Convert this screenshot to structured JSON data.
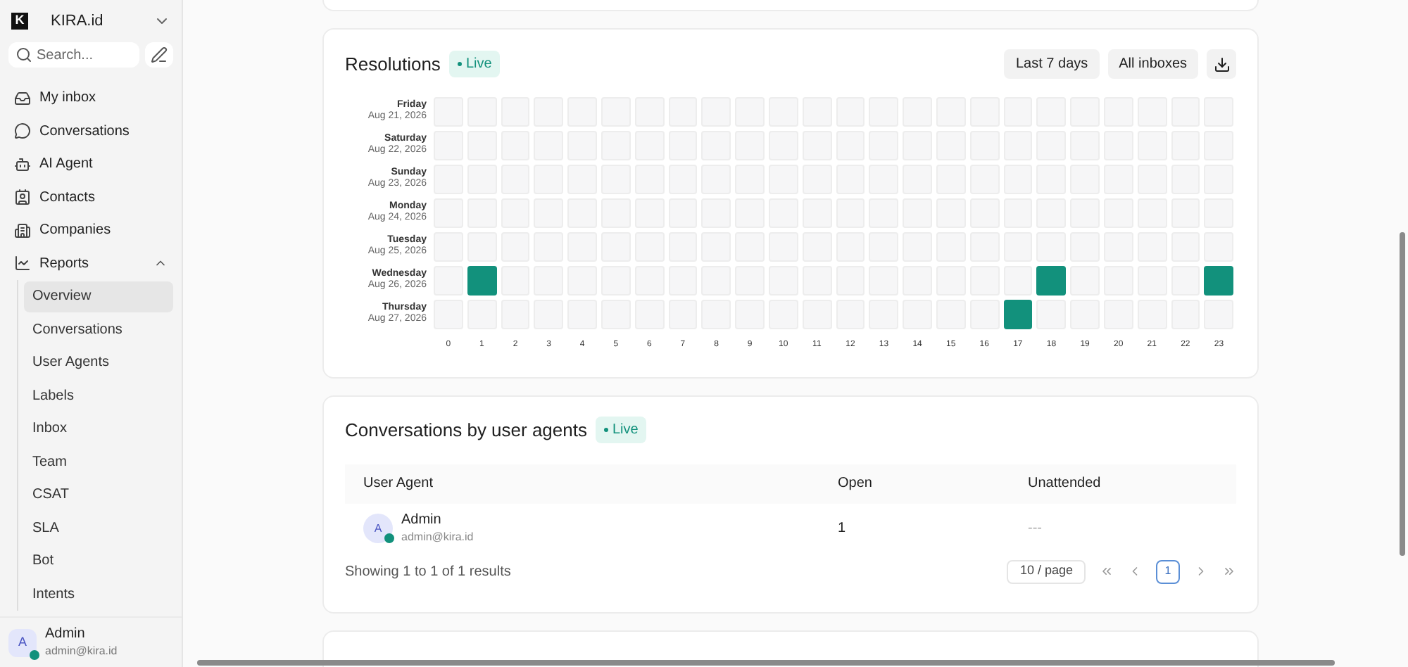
{
  "workspace": {
    "name": "KIRA.id",
    "logo": "K"
  },
  "search": {
    "placeholder": "Search..."
  },
  "nav": [
    {
      "label": "My inbox",
      "selected": false
    },
    {
      "label": "Conversations",
      "selected": false
    },
    {
      "label": "AI Agent",
      "selected": false
    },
    {
      "label": "Contacts",
      "selected": false
    },
    {
      "label": "Companies",
      "selected": false
    },
    {
      "label": "Reports",
      "selected": false,
      "expanded": true,
      "children": [
        {
          "label": "Overview",
          "selected": true
        },
        {
          "label": "Conversations",
          "selected": false
        },
        {
          "label": "User Agents",
          "selected": false
        },
        {
          "label": "Labels",
          "selected": false
        },
        {
          "label": "Inbox",
          "selected": false
        },
        {
          "label": "Team",
          "selected": false
        },
        {
          "label": "CSAT",
          "selected": false
        },
        {
          "label": "SLA",
          "selected": false
        },
        {
          "label": "Bot",
          "selected": false
        },
        {
          "label": "Intents",
          "selected": false
        }
      ]
    }
  ],
  "user": {
    "initial": "A",
    "name": "Admin",
    "email": "admin@kira.id",
    "online": true
  },
  "resolutions": {
    "title": "Resolutions",
    "badge": "Live",
    "filters": [
      "Last 7 days",
      "All inboxes"
    ],
    "rows": [
      {
        "day": "Friday",
        "date": "Aug 21, 2026",
        "filled": [
          false,
          false,
          false,
          false,
          false,
          false,
          false,
          false,
          false,
          false,
          false,
          false,
          false,
          false,
          false,
          false,
          false,
          false,
          false,
          false,
          false,
          false,
          false,
          false
        ]
      },
      {
        "day": "Saturday",
        "date": "Aug 22, 2026",
        "filled": [
          false,
          false,
          false,
          false,
          false,
          false,
          false,
          false,
          false,
          false,
          false,
          false,
          false,
          false,
          false,
          false,
          false,
          false,
          false,
          false,
          false,
          false,
          false,
          false
        ]
      },
      {
        "day": "Sunday",
        "date": "Aug 23, 2026",
        "filled": [
          false,
          false,
          false,
          false,
          false,
          false,
          false,
          false,
          false,
          false,
          false,
          false,
          false,
          false,
          false,
          false,
          false,
          false,
          false,
          false,
          false,
          false,
          false,
          false
        ]
      },
      {
        "day": "Monday",
        "date": "Aug 24, 2026",
        "filled": [
          false,
          false,
          false,
          false,
          false,
          false,
          false,
          false,
          false,
          false,
          false,
          false,
          false,
          false,
          false,
          false,
          false,
          false,
          false,
          false,
          false,
          false,
          false,
          false
        ]
      },
      {
        "day": "Tuesday",
        "date": "Aug 25, 2026",
        "filled": [
          false,
          false,
          false,
          false,
          false,
          false,
          false,
          false,
          false,
          false,
          false,
          false,
          false,
          false,
          false,
          false,
          false,
          false,
          false,
          false,
          false,
          false,
          false,
          false
        ]
      },
      {
        "day": "Wednesday",
        "date": "Aug 26, 2026",
        "filled": [
          false,
          true,
          false,
          false,
          false,
          false,
          false,
          false,
          false,
          false,
          false,
          false,
          false,
          false,
          false,
          false,
          false,
          false,
          true,
          false,
          false,
          false,
          false,
          true
        ]
      },
      {
        "day": "Thursday",
        "date": "Aug 27, 2026",
        "filled": [
          false,
          false,
          false,
          false,
          false,
          false,
          false,
          false,
          false,
          false,
          false,
          false,
          false,
          false,
          false,
          false,
          false,
          true,
          false,
          false,
          false,
          false,
          false,
          false
        ]
      }
    ],
    "hours": [
      "0",
      "1",
      "2",
      "3",
      "4",
      "5",
      "6",
      "7",
      "8",
      "9",
      "10",
      "11",
      "12",
      "13",
      "14",
      "15",
      "16",
      "17",
      "18",
      "19",
      "20",
      "21",
      "22",
      "23"
    ]
  },
  "agents": {
    "title": "Conversations by user agents",
    "badge": "Live",
    "columns": [
      "User Agent",
      "Open",
      "Unattended"
    ],
    "rows": [
      {
        "initial": "A",
        "name": "Admin",
        "email": "admin@kira.id",
        "online": true,
        "open": "1",
        "unattended": "---"
      }
    ],
    "summary": "Showing 1 to 1 of 1 results",
    "page_size": "10 / page",
    "pages": [
      {
        "label": "1",
        "selected": true
      }
    ]
  }
}
